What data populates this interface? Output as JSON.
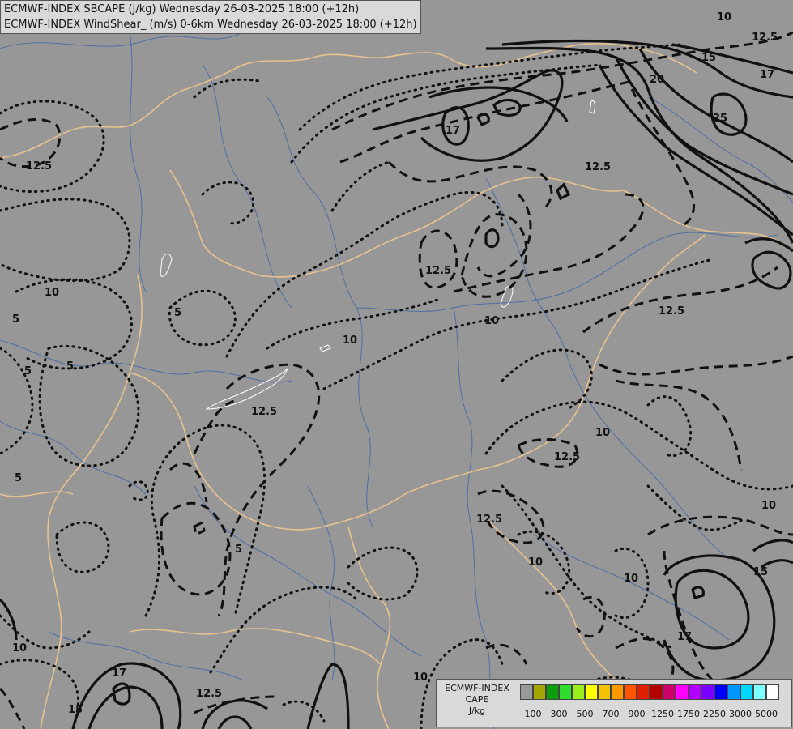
{
  "titles": {
    "line1": "ECMWF-INDEX SBCAPE (J/kg) Wednesday 26-03-2025 18:00 (+12h)",
    "line2": "ECMWF-INDEX WindShear_ (m/s) 0-6km Wednesday 26-03-2025 18:00 (+12h)"
  },
  "legend": {
    "line1": "ECMWF-INDEX",
    "line2": "CAPE",
    "line3": "J/kg",
    "colors": [
      "#9a9a9a",
      "#a3a600",
      "#0c9d0c",
      "#2ddc2d",
      "#9aee1a",
      "#ffff00",
      "#f2c200",
      "#ff9900",
      "#ff5500",
      "#e01f00",
      "#b30000",
      "#cc0066",
      "#ff00ff",
      "#b200ff",
      "#7a00ff",
      "#0000ff",
      "#0096ff",
      "#00d7ff",
      "#7dffff",
      "#ffffff"
    ],
    "ticks": [
      "100",
      "300",
      "500",
      "700",
      "900",
      "1250",
      "1750",
      "2250",
      "3000",
      "5000"
    ]
  },
  "contour_labels": [
    {
      "text": "10"
    },
    {
      "text": "12.5"
    },
    {
      "text": "15"
    },
    {
      "text": "17"
    },
    {
      "text": "20"
    },
    {
      "text": "25"
    },
    {
      "text": "17"
    },
    {
      "text": "12.5"
    },
    {
      "text": "12.5"
    },
    {
      "text": "12.5"
    },
    {
      "text": "10"
    },
    {
      "text": "10"
    },
    {
      "text": "10"
    },
    {
      "text": "5"
    },
    {
      "text": "5"
    },
    {
      "text": "5"
    },
    {
      "text": "5"
    },
    {
      "text": "12.5"
    },
    {
      "text": "12.5"
    },
    {
      "text": "10"
    },
    {
      "text": "12.5"
    },
    {
      "text": "12.5"
    },
    {
      "text": "10"
    },
    {
      "text": "10"
    },
    {
      "text": "15"
    },
    {
      "text": "17"
    },
    {
      "text": "10"
    },
    {
      "text": "10"
    },
    {
      "text": "12.5"
    },
    {
      "text": "17"
    },
    {
      "text": "15"
    },
    {
      "text": "5"
    },
    {
      "text": "10"
    },
    {
      "text": "5"
    }
  ]
}
